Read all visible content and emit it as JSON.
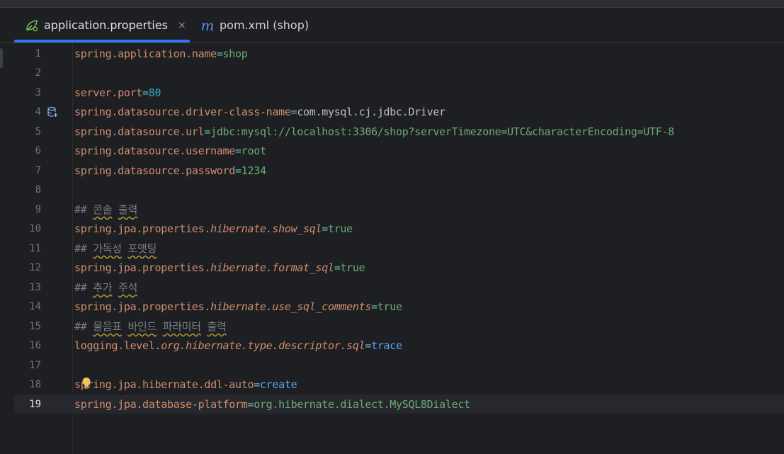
{
  "tabs": [
    {
      "label": "application.properties",
      "icon": "spring-leaf-icon",
      "active": true
    },
    {
      "label": "pom.xml (shop)",
      "icon": "maven-m-icon",
      "active": false
    }
  ],
  "tab_close_glyph": "×",
  "tab_icon_glyphs": {
    "maven": "m"
  },
  "current_line": 19,
  "lines": [
    {
      "n": "1",
      "key": "spring.application.name",
      "eq": "=",
      "val": "shop"
    },
    {
      "n": "2"
    },
    {
      "n": "3",
      "key": "server.port",
      "eq": "=",
      "val": "80"
    },
    {
      "n": "4",
      "key": "spring.datasource.driver-class-name",
      "eq": "=",
      "val": "com.mysql.cj.jdbc.Driver"
    },
    {
      "n": "5",
      "key": "spring.datasource.url",
      "eq": "=",
      "val": "jdbc:mysql://localhost:3306/shop?serverTimezone=UTC&characterEncoding=UTF-8"
    },
    {
      "n": "6",
      "key": "spring.datasource.username",
      "eq": "=",
      "val": "root"
    },
    {
      "n": "7",
      "key": "spring.datasource.password",
      "eq": "=",
      "val": "1234"
    },
    {
      "n": "8"
    },
    {
      "n": "9",
      "hash": "##",
      "comment": [
        "콘솔",
        "출력"
      ]
    },
    {
      "n": "10",
      "key_a": "spring.jpa.properties.",
      "key_b": "hibernate.show_sql",
      "eq": "=",
      "val": "true"
    },
    {
      "n": "11",
      "hash": "##",
      "comment": [
        "가독성",
        "포맷팅"
      ]
    },
    {
      "n": "12",
      "key_a": "spring.jpa.properties.",
      "key_b": "hibernate.format_sql",
      "eq": "=",
      "val": "true"
    },
    {
      "n": "13",
      "hash": "##",
      "comment": [
        "추가",
        "주석"
      ]
    },
    {
      "n": "14",
      "key_a": "spring.jpa.properties.",
      "key_b": "hibernate.use_sql_comments",
      "eq": "=",
      "val": "true"
    },
    {
      "n": "15",
      "hash": "##",
      "comment": [
        "물음표",
        "바인드",
        "파라미터",
        "출력"
      ]
    },
    {
      "n": "16",
      "key_a": "logging.level.",
      "key_b": "org.hibernate.type.descriptor.sql",
      "eq": "=",
      "val": "trace"
    },
    {
      "n": "17"
    },
    {
      "n": "18",
      "key": "spring.jpa.hibernate.ddl-auto",
      "eq": "=",
      "val": "create"
    },
    {
      "n": "19",
      "key": "spring.jpa.database-platform",
      "eq": "=",
      "val": "org.hibernate.dialect.MySQL8Dialect"
    }
  ],
  "gutter_icons": {
    "line4": "database-icon",
    "line18": "lightbulb-icon"
  },
  "colors": {
    "background": "#1e1f22",
    "key": "#cf8e6d",
    "value": "#6aab73",
    "keyword_value": "#56a8f5",
    "number": "#2aacb8",
    "comment": "#7a7e85",
    "tab_underline": "#3574f0"
  }
}
